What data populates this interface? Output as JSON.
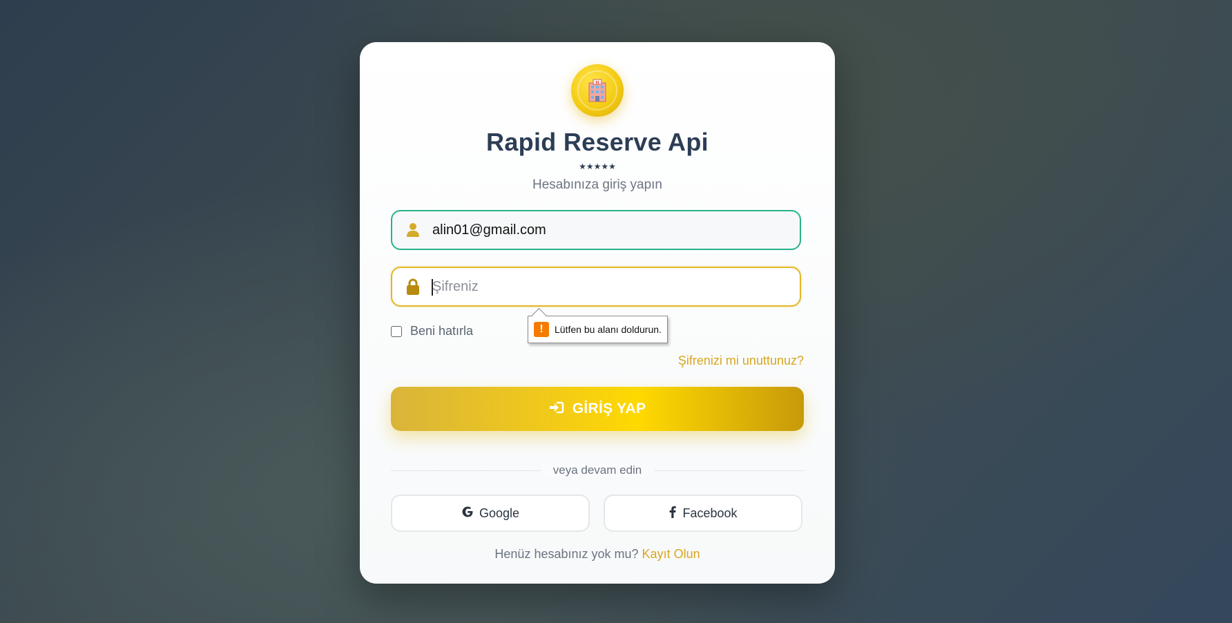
{
  "brand": {
    "title": "Rapid Reserve Api",
    "stars": "★★★★★",
    "subtitle": "Hesabınıza giriş yapın",
    "logo_icon": "hotel-icon"
  },
  "form": {
    "email_value": "alin01@gmail.com",
    "email_icon": "user-icon",
    "password_placeholder": "Şifreniz",
    "password_icon": "lock-icon",
    "remember_label": "Beni hatırla",
    "forgot_label": "Şifrenizi mi unuttunuz?",
    "login_label": "GİRİŞ YAP",
    "login_icon": "sign-in-icon"
  },
  "validation": {
    "message": "Lütfen bu alanı doldurun.",
    "icon": "warning-icon"
  },
  "social": {
    "divider_text": "veya devam edin",
    "google_label": "Google",
    "facebook_label": "Facebook"
  },
  "signup": {
    "prompt": "Henüz hesabınız yok mu?",
    "link_label": "Kayıt Olun"
  },
  "colors": {
    "accent": "#e2b722",
    "valid_border": "#27b38a",
    "title": "#2c3e55"
  }
}
